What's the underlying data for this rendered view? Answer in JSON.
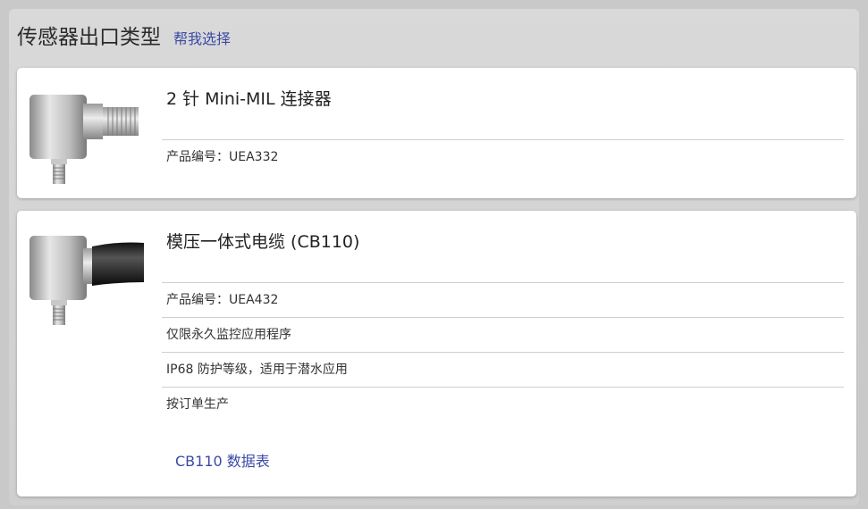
{
  "header": {
    "title": "传感器出口类型",
    "help_link": "帮我选择"
  },
  "products": [
    {
      "title": "2 针 Mini-MIL 连接器",
      "details": [
        "产品编号：UEA332"
      ],
      "image_icon": "sensor-mini-mil-connector-image"
    },
    {
      "title": "模压一体式电缆 (CB110)",
      "details": [
        "产品编号：UEA432",
        "仅限永久监控应用程序",
        "IP68 防护等级，适用于潜水应用",
        "按订单生产"
      ],
      "datasheet_link": "CB110 数据表",
      "image_icon": "sensor-molded-cable-image"
    }
  ],
  "colors": {
    "link": "#3b4aa5",
    "panel": "#d4d4d4",
    "card": "#ffffff"
  }
}
